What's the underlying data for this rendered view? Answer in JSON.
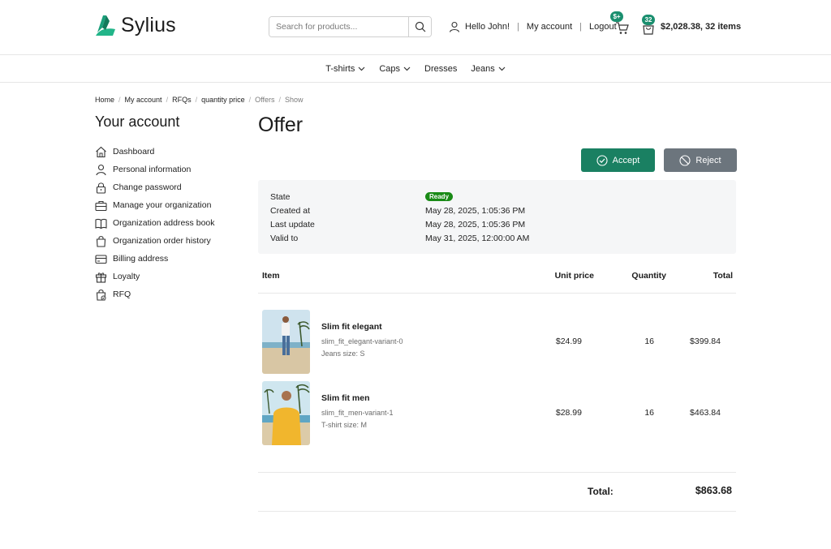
{
  "brand": {
    "name": "Sylius",
    "accent": "#1a9f7a"
  },
  "search": {
    "placeholder": "Search for products..."
  },
  "user": {
    "greeting": "Hello John!",
    "account_link": "My account",
    "logout_link": "Logout"
  },
  "compare": {
    "badge": "$+"
  },
  "cart": {
    "count": "32",
    "summary": "$2,028.38, 32 items"
  },
  "nav": {
    "items": [
      "T-shirts",
      "Caps",
      "Dresses",
      "Jeans"
    ]
  },
  "breadcrumb": {
    "items": [
      "Home",
      "My account",
      "RFQs",
      "quantity price",
      "Offers",
      "Show"
    ]
  },
  "sidebar": {
    "title": "Your account",
    "items": [
      {
        "label": "Dashboard",
        "icon": "home-icon"
      },
      {
        "label": "Personal information",
        "icon": "user-icon"
      },
      {
        "label": "Change password",
        "icon": "lock-icon"
      },
      {
        "label": "Manage your organization",
        "icon": "briefcase-icon"
      },
      {
        "label": "Organization address book",
        "icon": "book-icon"
      },
      {
        "label": "Organization order history",
        "icon": "bag-icon"
      },
      {
        "label": "Billing address",
        "icon": "card-icon"
      },
      {
        "label": "Loyalty",
        "icon": "gift-icon"
      },
      {
        "label": "RFQ",
        "icon": "bag-check-icon"
      }
    ]
  },
  "page": {
    "title": "Offer"
  },
  "actions": {
    "accept": "Accept",
    "reject": "Reject",
    "accept_color": "#1a8062",
    "reject_color": "#6c757d"
  },
  "info": {
    "state_label": "State",
    "state_value": "Ready",
    "state_color": "#198a16",
    "created_label": "Created at",
    "created_value": "May 28, 2025, 1:05:36 PM",
    "updated_label": "Last update",
    "updated_value": "May 28, 2025, 1:05:36 PM",
    "valid_label": "Valid to",
    "valid_value": "May 31, 2025, 12:00:00 AM"
  },
  "table": {
    "headers": {
      "item": "Item",
      "unit_price": "Unit price",
      "quantity": "Quantity",
      "total": "Total"
    },
    "rows": [
      {
        "name": "Slim fit elegant",
        "code": "slim_fit_elegant-variant-0",
        "option": "Jeans size: S",
        "unit_price": "$24.99",
        "quantity": "16",
        "total": "$399.84"
      },
      {
        "name": "Slim fit men",
        "code": "slim_fit_men-variant-1",
        "option": "T-shirt size: M",
        "unit_price": "$28.99",
        "quantity": "16",
        "total": "$463.84"
      }
    ],
    "total_label": "Total:",
    "total_value": "$863.68"
  }
}
